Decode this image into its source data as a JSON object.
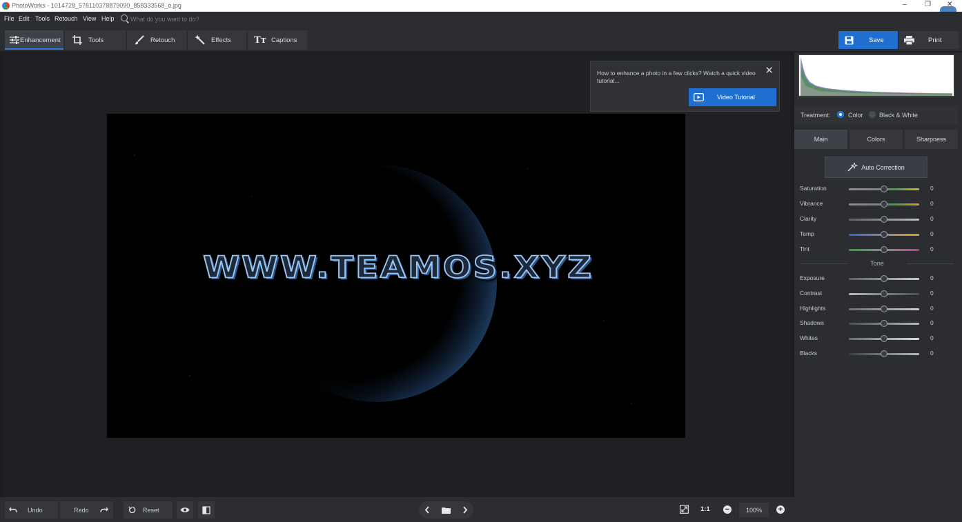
{
  "window": {
    "title": "PhotoWorks - 1014728_578110378879090_858333568_o.jpg",
    "controls": [
      "–",
      "❐",
      "✕"
    ]
  },
  "menu": {
    "items": [
      "File",
      "Edit",
      "Tools",
      "Retouch",
      "View",
      "Help"
    ],
    "search_placeholder": "What do you want to do?"
  },
  "toolbar": {
    "tabs": [
      {
        "label": "Enhancement",
        "icon": "sliders-icon",
        "active": true
      },
      {
        "label": "Tools",
        "icon": "crop-icon",
        "active": false
      },
      {
        "label": "Retouch",
        "icon": "brush-icon",
        "active": false
      },
      {
        "label": "Effects",
        "icon": "magic-wand-icon",
        "active": false
      },
      {
        "label": "Captions",
        "icon": "text-icon",
        "active": false
      }
    ],
    "save_label": "Save",
    "print_label": "Print",
    "accent": "#1e6fd0"
  },
  "photo": {
    "watermark_text": "WWW.TEAMOS.XYZ"
  },
  "tutorial": {
    "message": "How to enhance a photo in a few clicks? Watch a quick video tutorial...",
    "button_label": "Video Tutorial"
  },
  "panel": {
    "treatment_label": "Treatment:",
    "treatment_options": [
      {
        "label": "Color",
        "selected": true
      },
      {
        "label": "Black & White",
        "selected": false
      }
    ],
    "tabs": [
      {
        "label": "Main",
        "active": true
      },
      {
        "label": "Colors",
        "active": false
      },
      {
        "label": "Sharpness",
        "active": false
      }
    ],
    "auto_correction_label": "Auto Correction",
    "sliders_main": [
      {
        "label": "Saturation",
        "value": "0",
        "level": 0.5
      },
      {
        "label": "Vibrance",
        "value": "0",
        "level": 0.5
      },
      {
        "label": "Clarity",
        "value": "0",
        "level": 0.5
      },
      {
        "label": "Temp",
        "value": "0",
        "level": 0.5
      },
      {
        "label": "Tint",
        "value": "0",
        "level": 0.5
      }
    ],
    "tone_label": "Tone",
    "sliders_tone": [
      {
        "label": "Exposure",
        "value": "0",
        "level": 0.5
      },
      {
        "label": "Contrast",
        "value": "0",
        "level": 0.5
      },
      {
        "label": "Highlights",
        "value": "0",
        "level": 0.5
      },
      {
        "label": "Shadows",
        "value": "0",
        "level": 0.5
      },
      {
        "label": "Whites",
        "value": "0",
        "level": 0.5
      },
      {
        "label": "Blacks",
        "value": "0",
        "level": 0.5
      }
    ]
  },
  "bottom": {
    "undo_label": "Undo",
    "redo_label": "Redo",
    "reset_label": "Reset",
    "zoom_ratio_label": "1:1",
    "zoom_value": "100%"
  }
}
